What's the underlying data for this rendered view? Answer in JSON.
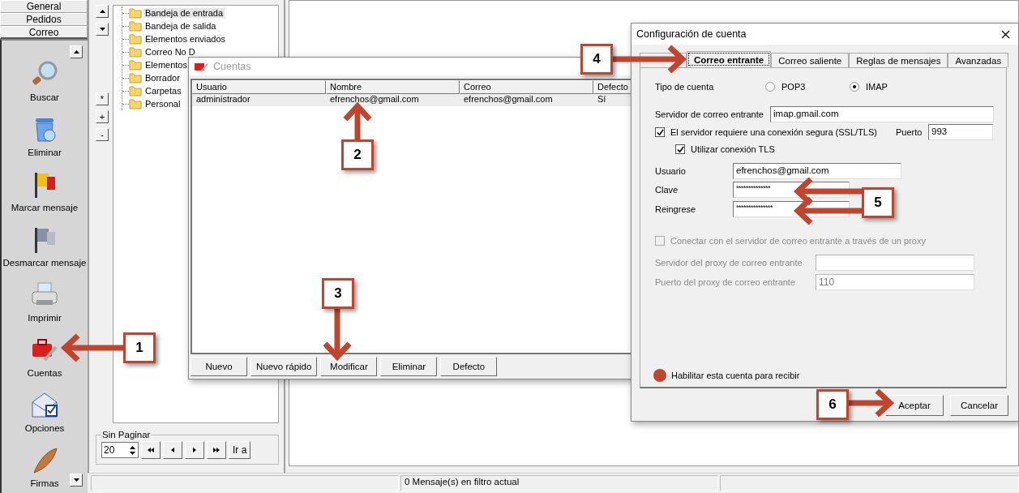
{
  "sidebar": {
    "tabs": [
      {
        "label": "General",
        "selected": false
      },
      {
        "label": "Pedidos",
        "selected": false
      },
      {
        "label": "Correo",
        "selected": true
      }
    ],
    "items": [
      {
        "label": "Buscar"
      },
      {
        "label": "Eliminar"
      },
      {
        "label": "Marcar mensaje"
      },
      {
        "label": "Desmarcar mensaje"
      },
      {
        "label": "Imprimir"
      },
      {
        "label": "Cuentas"
      },
      {
        "label": "Opciones"
      },
      {
        "label": "Firmas"
      }
    ]
  },
  "tree_buttons": [
    "*",
    "+",
    "-"
  ],
  "folders": [
    {
      "label": "Bandeja de entrada",
      "selected": true
    },
    {
      "label": "Bandeja de salida",
      "selected": false
    },
    {
      "label": "Elementos enviados",
      "selected": false
    },
    {
      "label": "Correo No D",
      "selected": false
    },
    {
      "label": "Elementos",
      "selected": false
    },
    {
      "label": "Borrador",
      "selected": false
    },
    {
      "label": "Carpetas",
      "selected": false
    },
    {
      "label": "Personal",
      "selected": false
    }
  ],
  "pager": {
    "title": "Sin Paginar",
    "page_size": "20",
    "go_label": "Ir a"
  },
  "status_bar": {
    "message": "0 Mensaje(s) en filtro actual"
  },
  "accounts_dialog": {
    "title": "Cuentas",
    "columns": [
      "Usuario",
      "Nombre",
      "Correo",
      "Defecto"
    ],
    "rows": [
      {
        "cells": [
          "administrador",
          "efrenchos@gmail.com",
          "efrenchos@gmail.com",
          "Sí"
        ],
        "selected": true
      }
    ],
    "buttons": [
      "Nuevo",
      "Nuevo rápido",
      "Modificar",
      "Eliminar",
      "Defecto"
    ]
  },
  "account_config": {
    "title": "Configuración de cuenta",
    "tabs": [
      {
        "label": "Correo entrante",
        "selected": true
      },
      {
        "label": "Correo saliente",
        "selected": false
      },
      {
        "label": "Reglas de mensajes",
        "selected": false
      },
      {
        "label": "Avanzadas",
        "selected": false
      }
    ],
    "account_type": {
      "label": "Tipo de cuenta",
      "options": [
        {
          "label": "POP3",
          "selected": false
        },
        {
          "label": "IMAP",
          "selected": true
        }
      ]
    },
    "server": {
      "label": "Servidor de correo entrante",
      "value": "imap.gmail.com"
    },
    "ssl": {
      "label": "El servidor requiere una conexión segura (SSL/TLS)",
      "checked": true
    },
    "port": {
      "label": "Puerto",
      "value": "993"
    },
    "tls": {
      "label": "Utilizar conexión TLS",
      "checked": true
    },
    "user": {
      "label": "Usuario",
      "value": "efrenchos@gmail.com"
    },
    "password": {
      "label": "Clave",
      "value": "**************"
    },
    "reenter": {
      "label": "Reingrese",
      "value": "***************"
    },
    "proxy": {
      "label": "Conectar con el servidor de correo entrante a través de un proxy",
      "checked": false,
      "disabled": true
    },
    "proxy_server": {
      "label": "Servidor del proxy de correo entrante",
      "disabled": true
    },
    "proxy_port": {
      "label": "Puerto del proxy de correo entrante",
      "value": "110",
      "disabled": true
    },
    "enable": {
      "label": "Habilitar esta cuenta para recibir"
    },
    "buttons": [
      "Aceptar",
      "Cancelar"
    ]
  },
  "callouts": [
    "1",
    "2",
    "3",
    "4",
    "5",
    "6"
  ]
}
